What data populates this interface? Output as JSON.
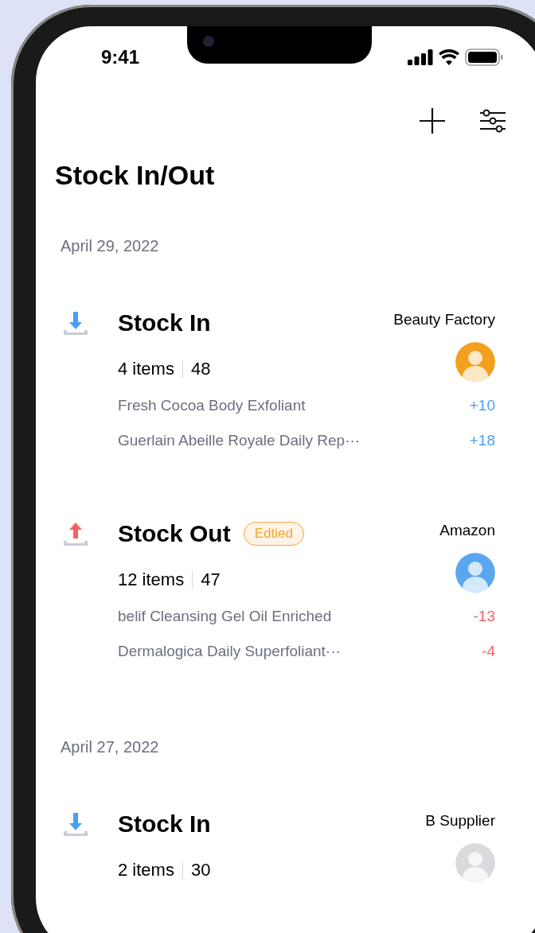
{
  "status_bar": {
    "time": "9:41"
  },
  "title": "Stock In/Out",
  "groups": [
    {
      "date": "April 29, 2022",
      "entries": [
        {
          "kind": "in",
          "title": "Stock In",
          "supplier": "Beauty Factory",
          "avatar": {
            "color": "#f2a01e"
          },
          "count": "4 items",
          "total": "48",
          "products": [
            {
              "name": "Fresh Cocoa Body Exfoliant",
              "qty": "+10"
            },
            {
              "name": "Guerlain Abeille Royale Daily Rep···",
              "qty": "+18"
            }
          ]
        },
        {
          "kind": "out",
          "title": "Stock Out",
          "badge": "Edtied",
          "supplier": "Amazon",
          "avatar": {
            "color": "#5aa6f0"
          },
          "count": "12 items",
          "total": "47",
          "products": [
            {
              "name": "belif Cleansing Gel Oil Enriched",
              "qty": "-13"
            },
            {
              "name": "Dermalogica Daily Superfoliant···",
              "qty": "-4"
            }
          ]
        }
      ]
    },
    {
      "date": "April 27, 2022",
      "entries": [
        {
          "kind": "in",
          "title": "Stock In",
          "supplier": "B Supplier",
          "avatar": {
            "color": "#d9dadd"
          },
          "count": "2 items",
          "total": "30"
        }
      ]
    }
  ]
}
